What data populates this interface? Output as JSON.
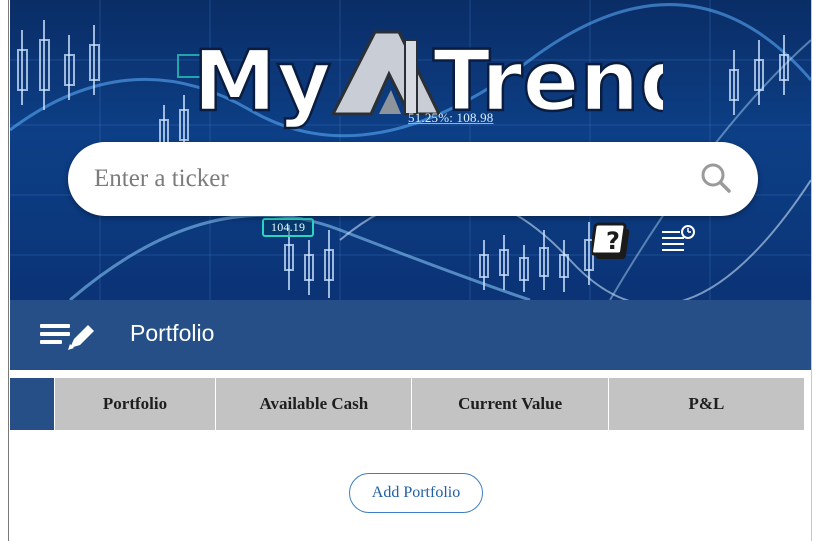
{
  "app": {
    "logo_text": "My AI Trend",
    "chart_tag_top": "51.25%: 108.98",
    "chart_tag_price": "104.19"
  },
  "search": {
    "placeholder": "Enter a ticker",
    "value": "",
    "icon": "search-icon"
  },
  "header_icons": {
    "help": "help-icon",
    "history": "history-list-icon"
  },
  "titlebar": {
    "icon": "edit-list-icon",
    "title": "Portfolio"
  },
  "table": {
    "columns": [
      "Portfolio",
      "Available Cash",
      "Current Value",
      "P&L"
    ],
    "rows": []
  },
  "actions": {
    "add_portfolio": "Add Portfolio"
  },
  "colors": {
    "banner": "#0d3f86",
    "titlebar": "#254f86",
    "table_header": "#c3c3c3",
    "button_border": "#3d7fc2"
  }
}
